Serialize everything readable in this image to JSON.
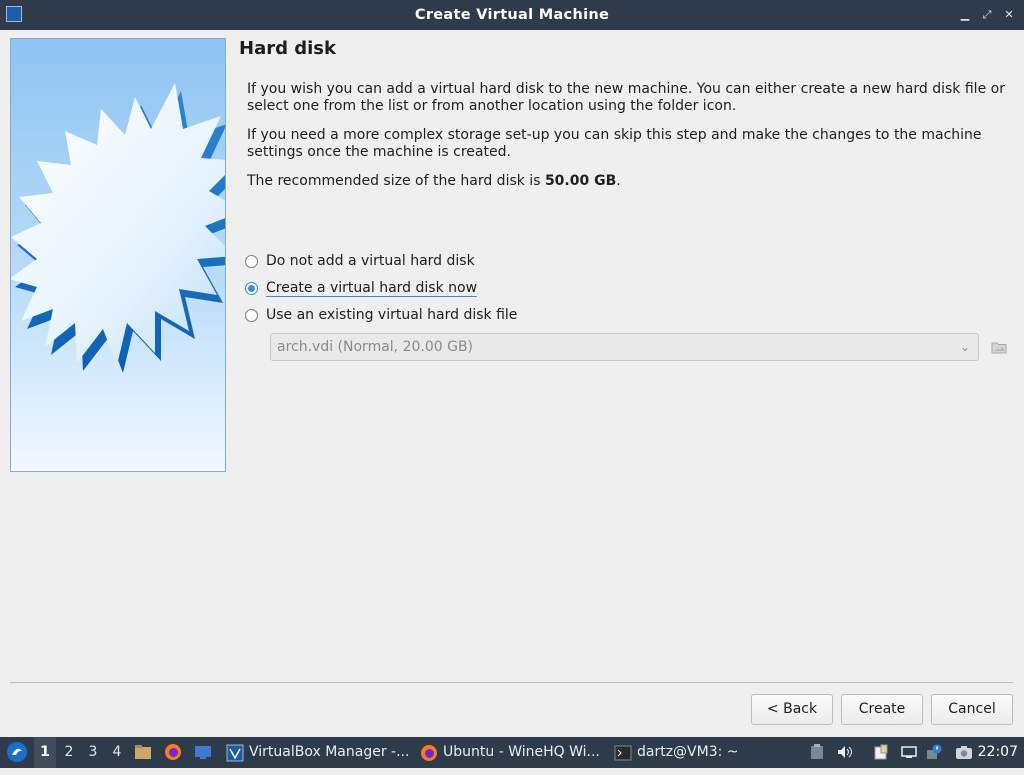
{
  "window": {
    "title": "Create Virtual Machine"
  },
  "page": {
    "heading": "Hard disk",
    "para1": "If you wish you can add a virtual hard disk to the new machine. You can either create a new hard disk file or select one from the list or from another location using the folder icon.",
    "para2": "If you need a more complex storage set-up you can skip this step and make the changes to the machine settings once the machine is created.",
    "para3_prefix": "The recommended size of the hard disk is ",
    "para3_size": "50.00 GB",
    "para3_suffix": "."
  },
  "options": [
    {
      "label": "Do not add a virtual hard disk",
      "checked": false
    },
    {
      "label": "Create a virtual hard disk now",
      "checked": true
    },
    {
      "label": "Use an existing virtual hard disk file",
      "checked": false
    }
  ],
  "disk_select": {
    "value": "arch.vdi (Normal, 20.00 GB)",
    "enabled": false
  },
  "buttons": {
    "back": "< Back",
    "create": "Create",
    "cancel": "Cancel"
  },
  "taskbar": {
    "workspaces": [
      "1",
      "2",
      "3",
      "4"
    ],
    "active_workspace": "1",
    "tasks": [
      {
        "label": "VirtualBox Manager -...",
        "icon": "virtualbox-icon"
      },
      {
        "label": "Ubuntu - WineHQ Wi...",
        "icon": "firefox-icon"
      },
      {
        "label": "dartz@VM3: ~",
        "icon": "terminal-icon"
      }
    ],
    "clock": "22:07"
  },
  "colors": {
    "titlebar": "#2e3b4a",
    "accent": "#3b8bd6",
    "dialog_bg": "#efefef"
  }
}
